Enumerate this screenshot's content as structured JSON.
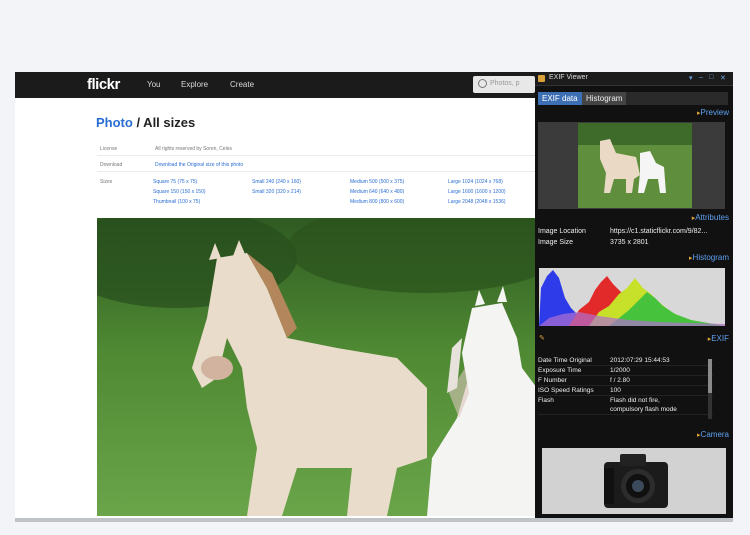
{
  "flickr": {
    "logo": "flickr",
    "nav": [
      "You",
      "Explore",
      "Create"
    ],
    "search_placeholder": "Photos, p",
    "title_link": "Photo",
    "title_rest": " / All sizes",
    "license_label": "License",
    "license_value": "All rights reserved by Soren, Celes",
    "download_label": "Download",
    "download_value": "Download the Original size of this photo",
    "sizes_label": "Sizes",
    "sizes": [
      [
        "Square 75 (75 x 75)",
        "Small 240 (240 x 160)",
        "Medium 500 (500 x 375)",
        "Large 1024 (1024 x 768)"
      ],
      [
        "Square 150 (150 x 150)",
        "Small 320 (320 x 214)",
        "Medium 640 (640 x 480)",
        "Large 1600 (1600 x 1200)"
      ],
      [
        "Thumbnail (100 x 75)",
        "",
        "Medium 800 (800 x 600)",
        "Large 2048 (2048 x 1536)"
      ]
    ]
  },
  "exif_viewer": {
    "title": "EXIF Viewer",
    "tabs": [
      "EXIF data",
      "Histogram"
    ],
    "sections": {
      "preview": "Preview",
      "attributes": "Attributes",
      "histogram": "Histogram",
      "exif": "EXIF",
      "camera": "Camera"
    },
    "attributes": [
      {
        "key": "Image Location",
        "value": "https://c1.staticflickr.com/9/82..."
      },
      {
        "key": "Image Size",
        "value": "3735 x 2801"
      }
    ],
    "exif": [
      {
        "key": "Date Time Original",
        "value": "2012:07:29 15:44:53"
      },
      {
        "key": "Exposure Time",
        "value": "1/2000"
      },
      {
        "key": "F Number",
        "value": "f / 2.80"
      },
      {
        "key": "ISO Speed Ratings",
        "value": "100"
      },
      {
        "key": "Flash",
        "value": "Flash did not fire,"
      },
      {
        "key": "",
        "value": "compulsory flash mode"
      }
    ]
  },
  "colors": {
    "accent": "#3d6fb4",
    "section_link": "#5fa1f0",
    "flickr_link": "#2a6ed3"
  }
}
